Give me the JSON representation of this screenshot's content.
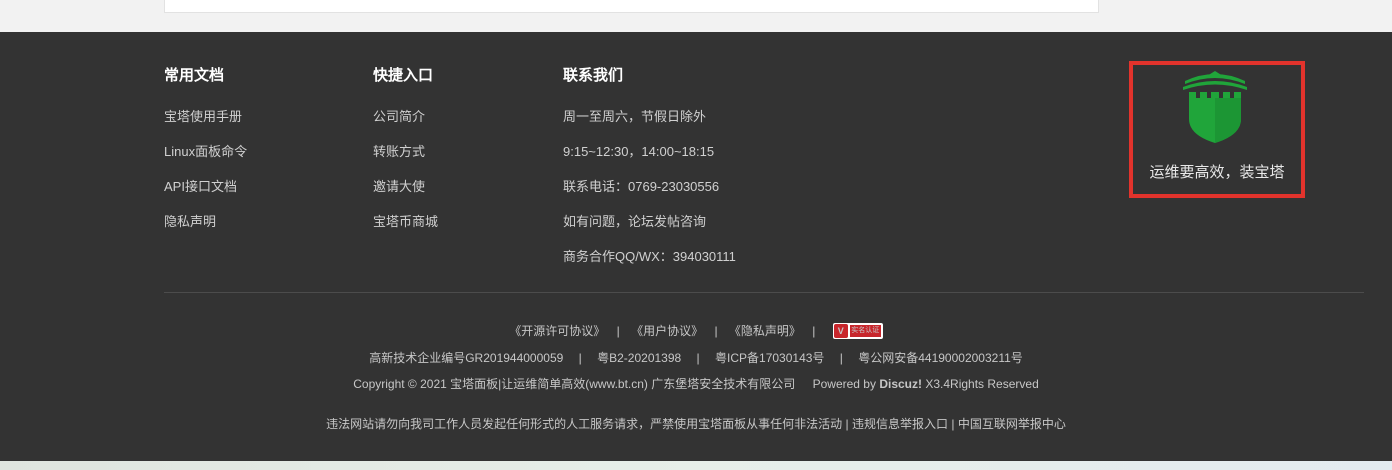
{
  "columns": [
    {
      "title": "常用文档",
      "items": [
        "宝塔使用手册",
        "Linux面板命令",
        "API接口文档",
        "隐私声明"
      ]
    },
    {
      "title": "快捷入口",
      "items": [
        "公司简介",
        "转账方式",
        "邀请大使",
        "宝塔币商城"
      ]
    },
    {
      "title": "联系我们",
      "items": [
        "周一至周六，节假日除外",
        "9:15~12:30，14:00~18:15",
        "联系电话：0769-23030556",
        "如有问题，论坛发帖咨询",
        "商务合作QQ/WX：394030111"
      ]
    }
  ],
  "brand": {
    "slogan": "运维要高效，装宝塔",
    "logo_icon": "green-shield-castle-icon",
    "highlight_color": "#e2332c",
    "logo_color": "#20a53a"
  },
  "bottom": {
    "links": [
      "《开源许可协议》",
      "《用户协议》",
      "《隐私声明》"
    ],
    "separator": "|",
    "badge": {
      "mark": "V",
      "text": "实名认证"
    },
    "registrations": [
      "高新技术企业编号GR201944000059",
      "粤B2-20201398",
      "粤ICP备17030143号",
      "粤公网安备44190002003211号"
    ],
    "copyright": "Copyright © 2021 宝塔面板|让运维简单高效(www.bt.cn) 广东堡塔安全技术有限公司",
    "powered_prefix": "Powered by",
    "powered_brand": "Discuz!",
    "powered_suffix": "X3.4Rights Reserved",
    "warning": "违法网站请勿向我司工作人员发起任何形式的人工服务请求，严禁使用宝塔面板从事任何非法活动",
    "report_links": [
      "违规信息举报入口",
      "中国互联网举报中心"
    ]
  },
  "colors": {
    "footer_bg": "#333333",
    "page_bg": "#f2f2f2"
  }
}
